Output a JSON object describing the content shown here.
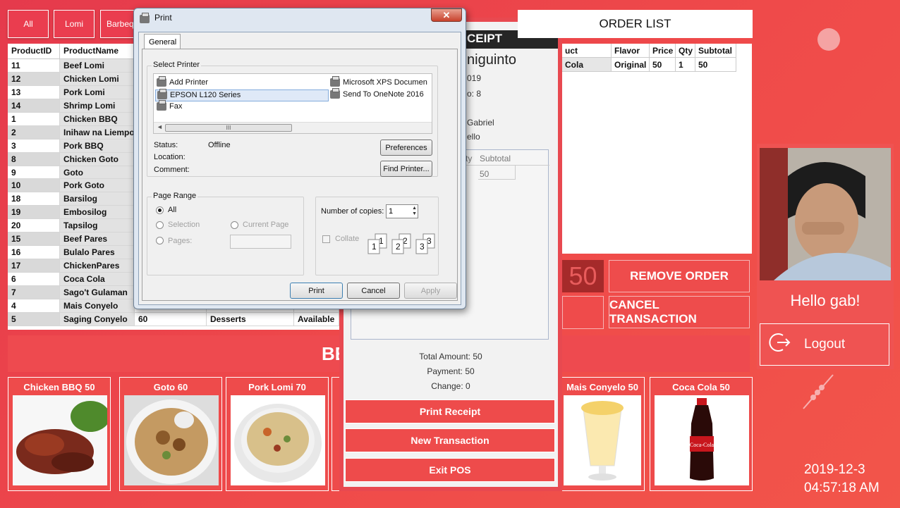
{
  "categories": [
    "All",
    "Lomi",
    "Barbeque"
  ],
  "product_table": {
    "columns": [
      "ProductID",
      "ProductName"
    ],
    "rows": [
      [
        "11",
        "Beef Lomi",
        "",
        "",
        ""
      ],
      [
        "12",
        "Chicken Lomi",
        "",
        "",
        ""
      ],
      [
        "13",
        "Pork Lomi",
        "",
        "",
        ""
      ],
      [
        "14",
        "Shrimp Lomi",
        "",
        "",
        ""
      ],
      [
        "1",
        "Chicken BBQ",
        "",
        "",
        ""
      ],
      [
        "2",
        "Inihaw na Liempo",
        "",
        "",
        ""
      ],
      [
        "3",
        "Pork BBQ",
        "",
        "",
        ""
      ],
      [
        "8",
        "Chicken Goto",
        "",
        "",
        ""
      ],
      [
        "9",
        "Goto",
        "",
        "",
        ""
      ],
      [
        "10",
        "Pork Goto",
        "",
        "",
        ""
      ],
      [
        "18",
        "Barsilog",
        "",
        "",
        ""
      ],
      [
        "19",
        "Embosilog",
        "",
        "",
        ""
      ],
      [
        "20",
        "Tapsilog",
        "",
        "",
        ""
      ],
      [
        "15",
        "Beef Pares",
        "",
        "",
        ""
      ],
      [
        "16",
        "Bulalo Pares",
        "",
        "",
        ""
      ],
      [
        "17",
        "ChickenPares",
        "",
        "",
        ""
      ],
      [
        "6",
        "Coca Cola",
        "",
        "",
        ""
      ],
      [
        "7",
        "Sago't Gulaman",
        "",
        "",
        ""
      ],
      [
        "4",
        "Mais Conyelo",
        "",
        "",
        ""
      ],
      [
        "5",
        "Saging Conyelo",
        "60",
        "Desserts",
        "Available"
      ]
    ]
  },
  "banner_text": "BE",
  "best_sellers": [
    {
      "label": "Chicken BBQ 50",
      "color": "#7a2a1c"
    },
    {
      "label": "Goto 60",
      "color": "#b48a55"
    },
    {
      "label": "Pork Lomi 70",
      "color": "#d8c08a"
    },
    {
      "label": "Mais Conyelo 50",
      "color": "#f4d16a"
    },
    {
      "label": "Coca Cola 50",
      "color": "#c8161d"
    }
  ],
  "receipt": {
    "header": "CEIPT",
    "name": "niguinto",
    "line1": "019",
    "line2": "o: 8",
    "line3": "Gabriel",
    "line4": "ello",
    "table_cols": [
      "ty",
      "Subtotal"
    ],
    "table_row": [
      "",
      "50"
    ],
    "total": "Total Amount: 50",
    "payment": "Payment: 50",
    "change": "Change: 0",
    "buttons": [
      "Print Receipt",
      "New Transaction",
      "Exit POS"
    ]
  },
  "order_list": {
    "title": "ORDER LIST",
    "columns": [
      "uct",
      "Flavor",
      "Price",
      "Qty",
      "Subtotal"
    ],
    "rows": [
      [
        "Cola",
        "Original",
        "50",
        "1",
        "50"
      ]
    ]
  },
  "total_display": "50",
  "remove_order": "REMOVE ORDER",
  "cancel_transaction": "CANCEL TRANSACTION",
  "user": {
    "greeting": "Hello gab!",
    "logout": "Logout"
  },
  "datetime": {
    "date": "2019-12-3",
    "time": "04:57:18 AM"
  },
  "print_dialog": {
    "title": "Print",
    "tab": "General",
    "select_printer_label": "Select Printer",
    "printers_col1": [
      "Add Printer",
      "EPSON L120 Series",
      "Fax"
    ],
    "printers_col2": [
      "Microsoft XPS Documen",
      "Send To OneNote 2016"
    ],
    "scroll_grip": "III",
    "status_label": "Status:",
    "status_value": "Offline",
    "location_label": "Location:",
    "comment_label": "Comment:",
    "preferences": "Preferences",
    "find_printer": "Find Printer...",
    "page_range": "Page Range",
    "all": "All",
    "selection": "Selection",
    "current_page": "Current Page",
    "pages": "Pages:",
    "copies_label": "Number of copies:",
    "copies_value": "1",
    "collate": "Collate",
    "print": "Print",
    "cancel": "Cancel",
    "apply": "Apply"
  },
  "colors": {
    "accent": "#ea3d4f",
    "dark_header": "#262626"
  }
}
